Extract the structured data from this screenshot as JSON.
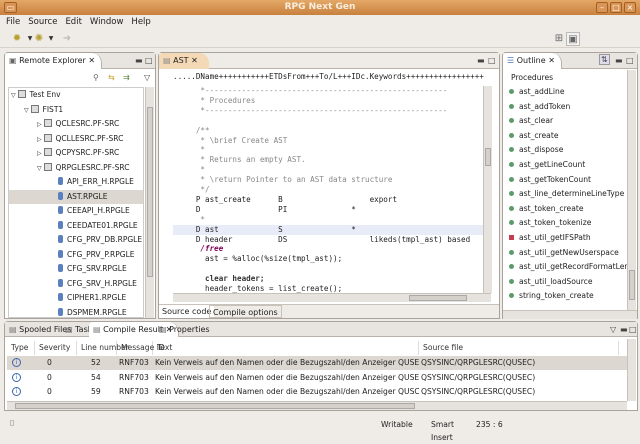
{
  "window": {
    "title": "RPG Next Gen"
  },
  "menu": [
    "File",
    "Source",
    "Edit",
    "Window",
    "Help"
  ],
  "remote_explorer": {
    "tab_label": "Remote Explorer",
    "tree": [
      {
        "label": "Test Env",
        "level": 0,
        "type": "host",
        "expanded": true
      },
      {
        "label": "FIST1",
        "level": 1,
        "type": "lib",
        "expanded": true
      },
      {
        "label": "QCLESRC.PF-SRC",
        "level": 2,
        "type": "srcpf",
        "expanded": false
      },
      {
        "label": "QCLLESRC.PF-SRC",
        "level": 2,
        "type": "srcpf",
        "expanded": false
      },
      {
        "label": "QCPYSRC.PF-SRC",
        "level": 2,
        "type": "srcpf",
        "expanded": false
      },
      {
        "label": "QRPGLESRC.PF-SRC",
        "level": 2,
        "type": "srcpf",
        "expanded": true
      },
      {
        "label": "API_ERR_H.RPGLE",
        "level": 3,
        "type": "member"
      },
      {
        "label": "AST.RPGLE",
        "level": 3,
        "type": "member",
        "selected": true
      },
      {
        "label": "CEEAPI_H.RPGLE",
        "level": 3,
        "type": "member"
      },
      {
        "label": "CEEDATE01.RPGLE",
        "level": 3,
        "type": "member"
      },
      {
        "label": "CFG_PRV_DB.RPGLE",
        "level": 3,
        "type": "member"
      },
      {
        "label": "CFG_PRV_P.RPGLE",
        "level": 3,
        "type": "member"
      },
      {
        "label": "CFG_SRV.RPGLE",
        "level": 3,
        "type": "member"
      },
      {
        "label": "CFG_SRV_H.RPGLE",
        "level": 3,
        "type": "member"
      },
      {
        "label": "CIPHER1.RPGLE",
        "level": 3,
        "type": "member"
      },
      {
        "label": "DSPMEM.RPGLE",
        "level": 3,
        "type": "member"
      }
    ]
  },
  "editor": {
    "tab_label": "AST",
    "ruler": ".....DName+++++++++++ETDsFrom+++To/L+++IDc.Keywords+++++++++++++++++",
    "lines": [
      {
        "text": "      *-----------------------------------------------------",
        "style": "cm"
      },
      {
        "text": "      * Procedures",
        "style": "cm"
      },
      {
        "text": "      *-----------------------------------------------------",
        "style": "cm"
      },
      {
        "text": "",
        "style": ""
      },
      {
        "text": "     /**",
        "style": "cm"
      },
      {
        "text": "      * \\brief Create AST",
        "style": "cm"
      },
      {
        "text": "      *",
        "style": "cm"
      },
      {
        "text": "      * Returns an empty AST.",
        "style": "cm"
      },
      {
        "text": "      *",
        "style": "cm"
      },
      {
        "text": "      * \\return Pointer to an AST data structure",
        "style": "cm"
      },
      {
        "text": "      */",
        "style": "cm"
      },
      {
        "text": "     P ast_create      B                   export",
        "style": ""
      },
      {
        "text": "     D                 PI              *",
        "style": ""
      },
      {
        "text": "      *",
        "style": "cm"
      },
      {
        "text": "     D ast             S               *",
        "style": "hl"
      },
      {
        "text": "     D header          DS                  likeds(tmpl_ast) based",
        "style": ""
      },
      {
        "text": "      /free",
        "style": "free"
      },
      {
        "text": "       ast = %alloc(%size(tmpl_ast));",
        "style": ""
      },
      {
        "text": "",
        "style": ""
      },
      {
        "text": "       clear header;",
        "style": "clear"
      },
      {
        "text": "       header_tokens = list_create();",
        "style": ""
      }
    ],
    "bottom_tabs": [
      "Source code",
      "Compile options"
    ]
  },
  "outline": {
    "tab_label": "Outline",
    "heading": "Procedures",
    "items": [
      {
        "label": "ast_addLine",
        "private": false
      },
      {
        "label": "ast_addToken",
        "private": false
      },
      {
        "label": "ast_clear",
        "private": false
      },
      {
        "label": "ast_create",
        "private": false
      },
      {
        "label": "ast_dispose",
        "private": false
      },
      {
        "label": "ast_getLineCount",
        "private": false
      },
      {
        "label": "ast_getTokenCount",
        "private": false
      },
      {
        "label": "ast_line_determineLineType",
        "private": false
      },
      {
        "label": "ast_token_create",
        "private": false
      },
      {
        "label": "ast_token_tokenize",
        "private": false
      },
      {
        "label": "ast_util_getIFSPath",
        "private": true
      },
      {
        "label": "ast_util_getNewUserspace",
        "private": false
      },
      {
        "label": "ast_util_getRecordFormatLength",
        "private": false
      },
      {
        "label": "ast_util_loadSource",
        "private": false
      },
      {
        "label": "string_token_create",
        "private": false
      }
    ]
  },
  "bottom_panel": {
    "tabs": [
      "Spooled Files",
      "Tasks",
      "Compile Result",
      "Properties"
    ],
    "active_tab": "Compile Result",
    "columns": [
      "Type",
      "Severity",
      "Line number",
      "Message ID",
      "Text",
      "Source file"
    ],
    "rows": [
      {
        "severity": "0",
        "line": "52",
        "msgid": "RNF7031",
        "text": "Kein Verweis auf den Namen oder die Bezugszahl/den Anzeiger QUSEI vorhanden.",
        "source": "QSYSINC/QRPGLESRC(QUSEC)"
      },
      {
        "severity": "0",
        "line": "54",
        "msgid": "RNF7031",
        "text": "Kein Verweis auf den Namen oder die Bezugszahl/den Anzeiger QUSERVED vorhanden.",
        "source": "QSYSINC/QRPGLESRC(QUSEC)"
      },
      {
        "severity": "0",
        "line": "59",
        "msgid": "RNF7031",
        "text": "Kein Verweis auf den Namen oder die Bezugszahl/den Anzeiger QUSC0200 vorhanden.",
        "source": "QSYSINC/QRPGLESRC(QUSEC)"
      }
    ]
  },
  "status": {
    "mode": "Writable",
    "insert": "Smart Insert",
    "position": "235 : 6"
  },
  "colors": {
    "title_bar": "#d08a48",
    "active_tab": "#f3d9b6",
    "selection": "#dcd7d1",
    "info_icon": "#3a63b0",
    "private_proc": "#c04050",
    "public_proc": "#5c9a6a"
  }
}
